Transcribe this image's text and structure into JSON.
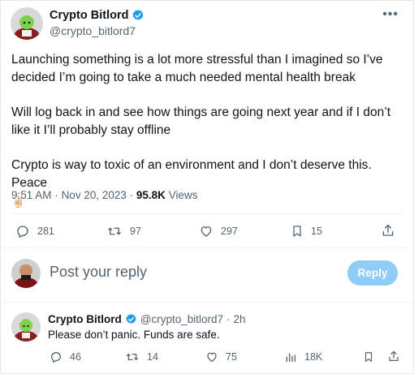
{
  "tweet": {
    "author_name": "Crypto Bitlord",
    "author_handle": "@crypto_bitlord7",
    "more_glyph": "•••",
    "paragraphs": [
      "Launching something is a lot more stressful than I imagined so I’ve decided I’m going to take a much needed mental health break",
      "Will log back in and see how things are going next year and if I don’t like it I’ll probably stay offline",
      "Crypto is way to toxic of an environment and I don’t deserve this. Peace"
    ],
    "emoji": "✌🏻",
    "time": "9:51 AM",
    "dot": "·",
    "date": "Nov 20, 2023",
    "views_count": "95.8K",
    "views_label": "Views",
    "actions": {
      "replies": "281",
      "reposts": "97",
      "likes": "297",
      "bookmarks": "15"
    }
  },
  "composer": {
    "placeholder": "Post your reply",
    "button_label": "Reply"
  },
  "reply": {
    "author_name": "Crypto Bitlord",
    "author_handle": "@crypto_bitlord7",
    "time": "2h",
    "text": "Please don’t panic. Funds are safe.",
    "actions": {
      "replies": "46",
      "reposts": "14",
      "likes": "75",
      "views": "18K"
    }
  },
  "colors": {
    "verified": "#1d9bf0",
    "secondary_text": "#536471",
    "reply_button": "#8ecdf7"
  }
}
